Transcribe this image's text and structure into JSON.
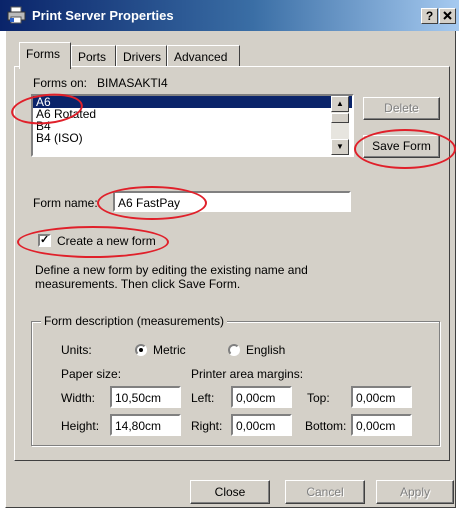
{
  "window": {
    "title": "Print Server Properties",
    "help_button": "?",
    "close_button": "X"
  },
  "tabs": [
    "Forms",
    "Ports",
    "Drivers",
    "Advanced"
  ],
  "forms_on": {
    "label": "Forms on:",
    "server": "BIMASAKTI4"
  },
  "forms_list": {
    "items": [
      "A6",
      "A6 Rotated",
      "B4",
      "B4 (ISO)"
    ],
    "selected": "A6"
  },
  "buttons": {
    "delete": "Delete",
    "save_form": "Save Form",
    "close": "Close",
    "cancel": "Cancel",
    "apply": "Apply"
  },
  "form_name": {
    "label": "Form name:",
    "value": "A6 FastPay"
  },
  "create_new_form": {
    "label": "Create a new form",
    "checked": true
  },
  "instructions": {
    "line1": "Define a new form by editing the existing name and",
    "line2": "measurements.  Then click Save Form."
  },
  "description": {
    "legend": "Form description (measurements)",
    "units_label": "Units:",
    "unit_metric": "Metric",
    "unit_english": "English",
    "selected_unit": "Metric",
    "paper_size_label": "Paper size:",
    "margins_label": "Printer area margins:",
    "width_label": "Width:",
    "width_value": "10,50cm",
    "height_label": "Height:",
    "height_value": "14,80cm",
    "left_label": "Left:",
    "left_value": "0,00cm",
    "right_label": "Right:",
    "right_value": "0,00cm",
    "top_label": "Top:",
    "top_value": "0,00cm",
    "bottom_label": "Bottom:",
    "bottom_value": "0,00cm"
  },
  "annotation_color": "#e0202a"
}
